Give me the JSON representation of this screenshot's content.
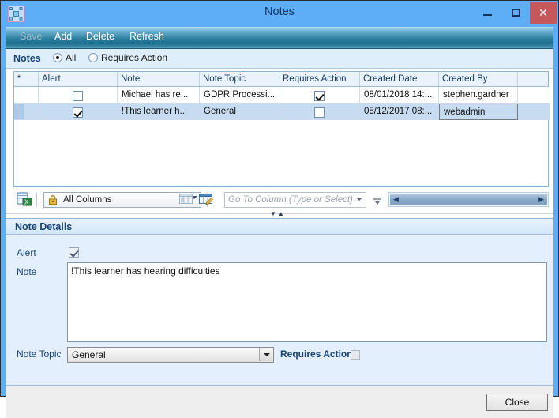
{
  "window": {
    "title": "Notes",
    "icon": "app-icon",
    "controls": {
      "minimize": "minimize-button",
      "maximize": "maximize-button",
      "close_glyph": "✕"
    }
  },
  "toolbar": {
    "items": [
      {
        "label": "Save",
        "disabled": true
      },
      {
        "label": "Add",
        "disabled": false
      },
      {
        "label": "Delete",
        "disabled": false
      },
      {
        "label": "Refresh",
        "disabled": false
      }
    ]
  },
  "filter": {
    "label": "Notes",
    "options": [
      {
        "label": "All",
        "selected": true
      },
      {
        "label": "Requires Action",
        "selected": false
      }
    ]
  },
  "grid": {
    "columns": [
      "*",
      "Alert",
      "Note",
      "Note Topic",
      "Requires Action",
      "Created Date",
      "Created By"
    ],
    "rows": [
      {
        "alert": false,
        "note": "Michael has re...",
        "note_topic": "GDPR Processi...",
        "requires_action": true,
        "created_date": "08/01/2018 14:...",
        "created_by": "stephen.gardner",
        "selected": false
      },
      {
        "alert": true,
        "note": "!This learner h...",
        "note_topic": "General",
        "requires_action": false,
        "created_date": "05/12/2017 08:...",
        "created_by": "webadmin",
        "selected": true
      }
    ]
  },
  "gridbar": {
    "export_icon": "export-to-excel-icon",
    "columns_filter": {
      "value": "All Columns",
      "icon": "lock-icon"
    },
    "layout_icon": "column-layout-icon",
    "edit_layout_icon": "edit-column-layout-icon",
    "goto_column": {
      "value": "",
      "placeholder": "Go To Column (Type or Select)"
    },
    "scroll_left_glyph": "◀",
    "scroll_right_glyph": "▶"
  },
  "details": {
    "header": "Note Details",
    "alert_label": "Alert",
    "alert_checked": true,
    "note_label": "Note",
    "note_value": "!This learner has hearing difficulties",
    "note_topic_label": "Note Topic",
    "note_topic_value": "General",
    "requires_action_label": "Requires Action",
    "requires_action_checked": false
  },
  "footer": {
    "close_label": "Close"
  },
  "colors": {
    "frame": "#5daef7",
    "title_text": "#10325c",
    "close_button": "#c6575a",
    "accent_label": "#17457c",
    "selected_row": "#c7dcf0",
    "details_bg": "#e3effc"
  }
}
